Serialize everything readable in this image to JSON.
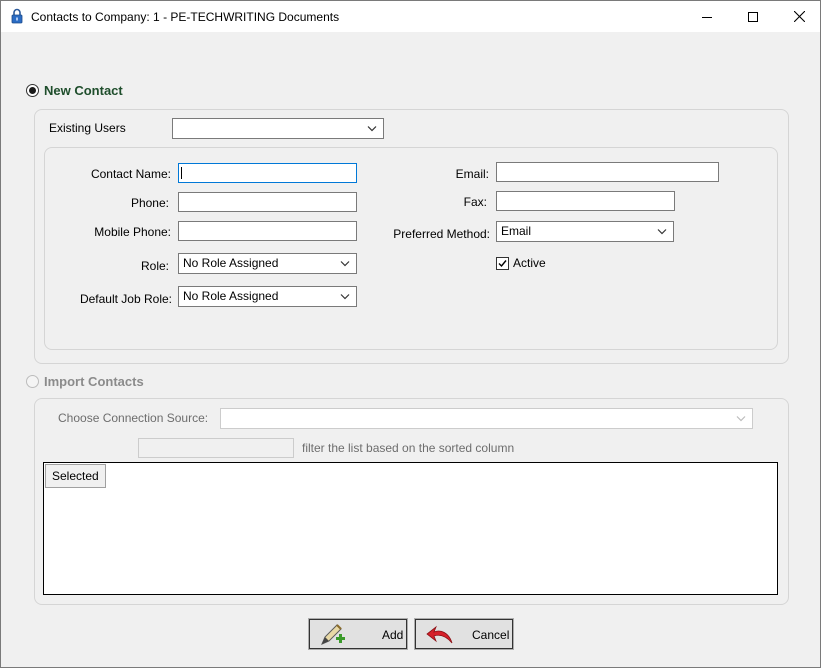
{
  "window": {
    "title": "Contacts to Company: 1 - PE-TECHWRITING Documents",
    "icons": {
      "app": "padlock-icon",
      "minimize": "minimize-icon",
      "maximize": "maximize-icon",
      "close": "close-icon"
    }
  },
  "new_contact": {
    "radio_label": "New Contact",
    "selected": true,
    "existing_users_label": "Existing Users",
    "existing_users_value": "",
    "contact_name_label": "Contact Name:",
    "contact_name_value": "",
    "phone_label": "Phone:",
    "phone_value": "",
    "mobile_phone_label": "Mobile Phone:",
    "mobile_phone_value": "",
    "role_label": "Role:",
    "role_value": "No Role Assigned",
    "default_job_role_label": "Default Job Role:",
    "default_job_role_value": "No Role Assigned",
    "email_label": "Email:",
    "email_value": "",
    "fax_label": "Fax:",
    "fax_value": "",
    "preferred_method_label": "Preferred Method:",
    "preferred_method_value": "Email",
    "active_label": "Active",
    "active_checked": true
  },
  "import_contacts": {
    "radio_label": "Import Contacts",
    "selected": false,
    "connection_source_label": "Choose Connection Source:",
    "connection_source_value": "",
    "filter_hint": "filter the list based on the sorted column",
    "filter_value": "",
    "columns": [
      "Selected"
    ],
    "rows": []
  },
  "buttons": {
    "add_label": "Add",
    "add_icon": "pencil-plus-icon",
    "cancel_label": "Cancel",
    "cancel_icon": "undo-arrow-icon"
  },
  "colors": {
    "section_title": "#1f4e2c",
    "focus_border": "#0078d7",
    "cancel_arrow": "#d6202a",
    "add_plus": "#3a9a2a"
  }
}
